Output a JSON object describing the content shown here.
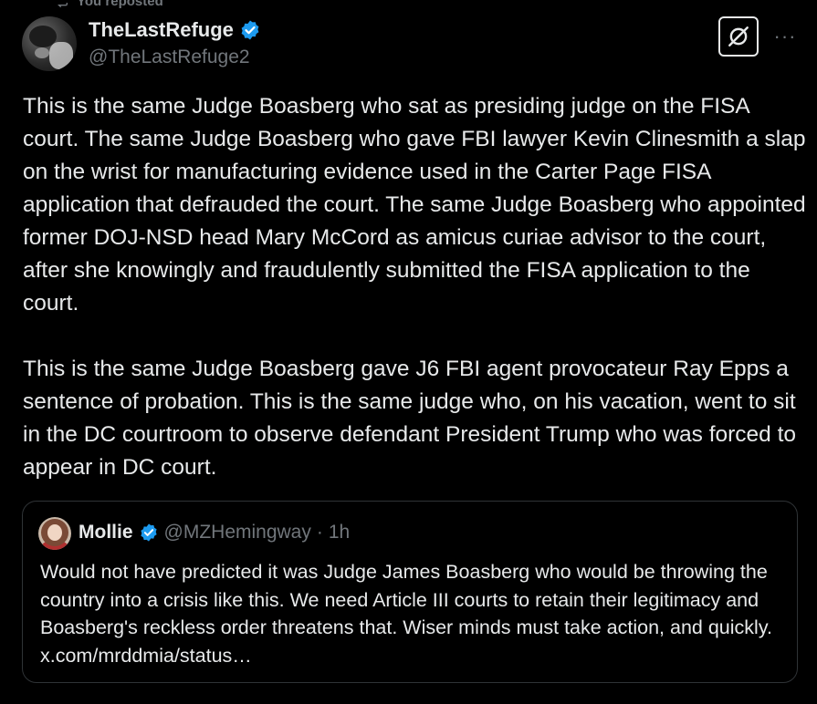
{
  "repost": {
    "label": "You reposted",
    "icon": "repost-icon"
  },
  "post": {
    "author": {
      "display_name": "TheLastRefuge",
      "handle": "@TheLastRefuge2",
      "verified_icon": "verified-badge-icon",
      "avatar_icon": "avatar"
    },
    "actions": {
      "grok_icon": "grok-icon",
      "more_icon": "more-icon",
      "more_label": "···"
    },
    "paragraphs": [
      "This is the same Judge Boasberg who sat as presiding judge on the FISA court.  The same Judge Boasberg who gave FBI lawyer Kevin Clinesmith a slap on the wrist for manufacturing evidence used in the Carter Page FISA application that defrauded the court.  The same Judge Boasberg who appointed former DOJ-NSD head Mary McCord as amicus curiae advisor to the court, after she knowingly and fraudulently submitted the FISA application to the court.",
      "This is the same Judge Boasberg gave J6 FBI agent provocateur Ray Epps a sentence of probation.  This is the same judge who, on his vacation, went to sit in the DC courtroom to observe defendant President Trump who was forced to appear in DC court."
    ]
  },
  "quote": {
    "display_name": "Mollie",
    "handle": "@MZHemingway",
    "separator": "·",
    "time": "1h",
    "text": "Would not have predicted it was Judge James Boasberg who would be throwing the country into a crisis like this. We need Article III courts to retain their legitimacy and Boasberg's reckless order threatens that. Wiser minds must take action, and quickly. x.com/mrddmia/status…"
  },
  "colors": {
    "background": "#000000",
    "text_primary": "#e7e9ea",
    "text_secondary": "#71767b",
    "verified_blue": "#1d9bf0",
    "border": "#2f3336"
  }
}
